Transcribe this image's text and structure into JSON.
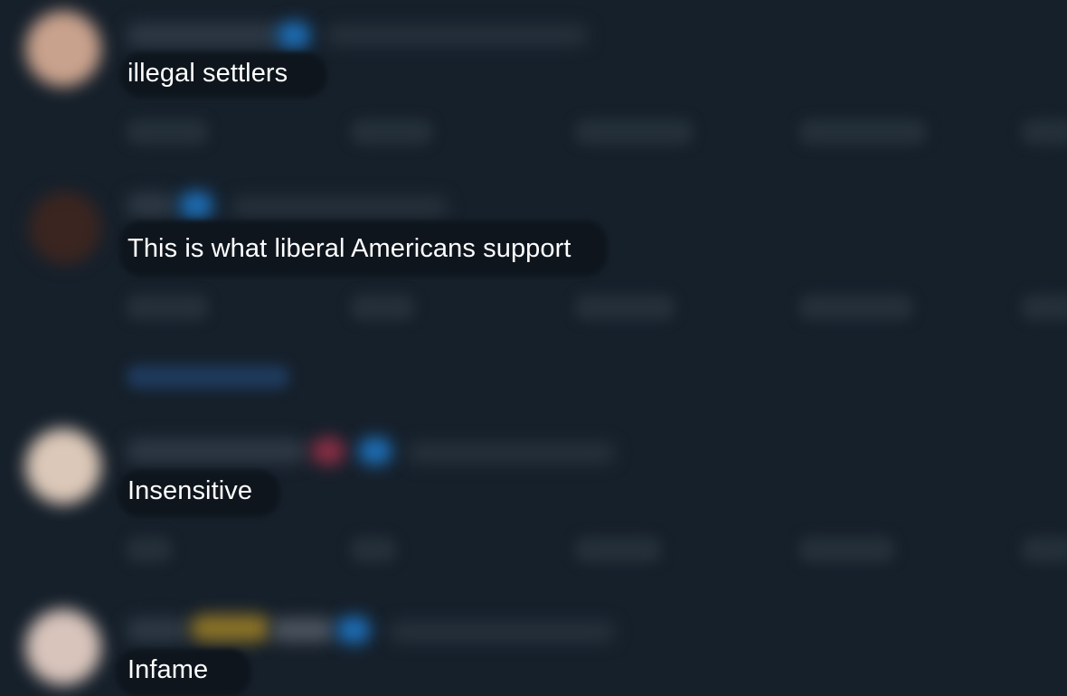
{
  "replies": [
    {
      "text": "illegal settlers",
      "avatar_color": "#c9a28d"
    },
    {
      "text": "This is what liberal Americans support",
      "avatar_color": "#3b2520"
    },
    {
      "text": "Insensitive",
      "avatar_color": "#dcc8b8"
    },
    {
      "text": "Infame",
      "avatar_color": "#d8c4bb"
    }
  ],
  "colors": {
    "background": "#16202b",
    "verified_badge": "#1d6fb8",
    "reply_text": "#ffffff"
  }
}
